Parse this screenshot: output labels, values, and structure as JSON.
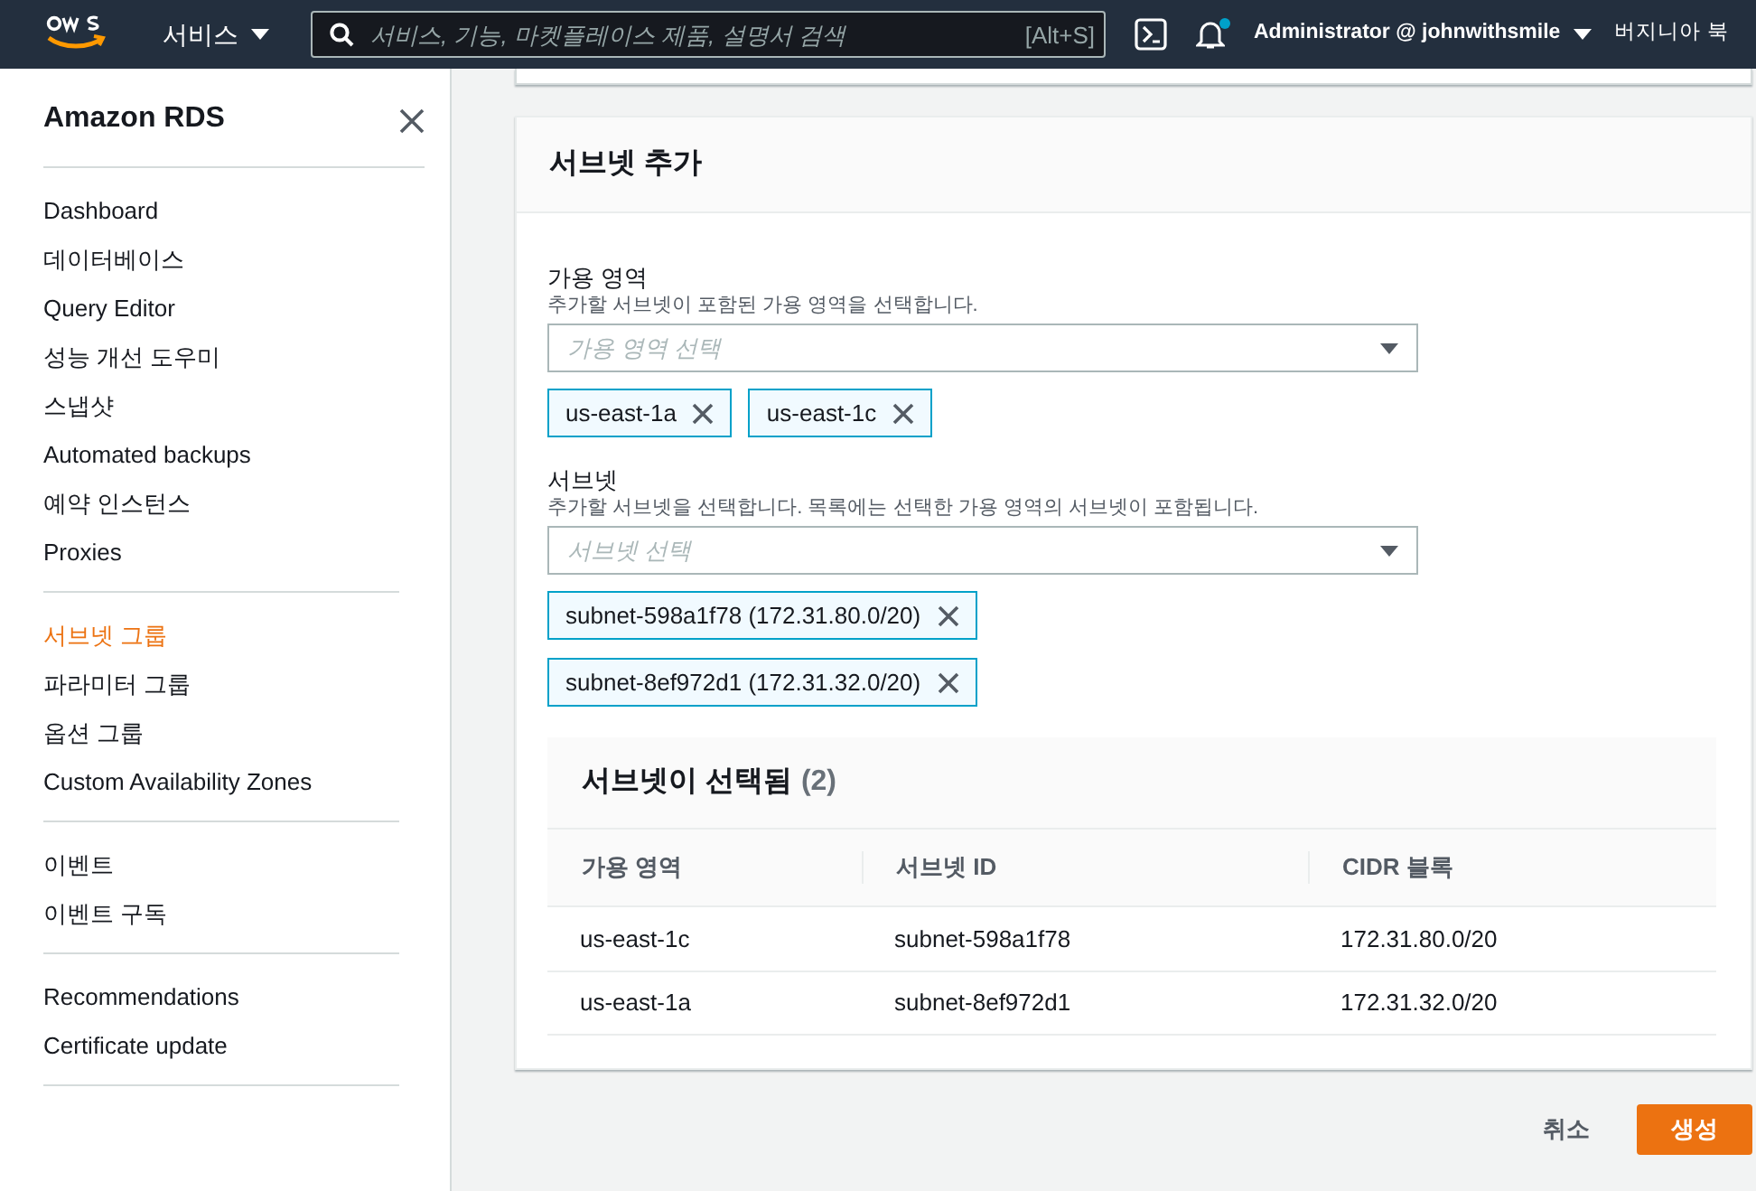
{
  "navbar": {
    "services_label": "서비스",
    "search": {
      "placeholder": "서비스, 기능, 마켓플레이스 제품, 설명서 검색",
      "shortcut": "[Alt+S]"
    },
    "notifications": {
      "unread": true
    },
    "account": "Administrator @ johnwithsmile",
    "region": "버지니아 북"
  },
  "sidebar": {
    "title": "Amazon RDS",
    "groups": [
      [
        {
          "label": "Dashboard",
          "selected": false
        },
        {
          "label": "데이터베이스",
          "selected": false
        },
        {
          "label": "Query Editor",
          "selected": false
        },
        {
          "label": "성능 개선 도우미",
          "selected": false
        },
        {
          "label": "스냅샷",
          "selected": false
        },
        {
          "label": "Automated backups",
          "selected": false
        },
        {
          "label": "예약 인스턴스",
          "selected": false
        },
        {
          "label": "Proxies",
          "selected": false
        }
      ],
      [
        {
          "label": "서브넷 그룹",
          "selected": true
        },
        {
          "label": "파라미터 그룹",
          "selected": false
        },
        {
          "label": "옵션 그룹",
          "selected": false
        },
        {
          "label": "Custom Availability Zones",
          "selected": false
        }
      ],
      [
        {
          "label": "이벤트",
          "selected": false
        },
        {
          "label": "이벤트 구독",
          "selected": false
        }
      ],
      [
        {
          "label": "Recommendations",
          "selected": false
        },
        {
          "label": "Certificate update",
          "selected": false
        }
      ]
    ]
  },
  "form": {
    "title": "서브넷 추가",
    "fields": [
      {
        "label": "가용 영역",
        "description": "추가할 서브넷이 포함된 가용 영역을 선택합니다.",
        "placeholder": "가용 영역 선택",
        "tokens": [
          "us-east-1a",
          "us-east-1c"
        ]
      },
      {
        "label": "서브넷",
        "description": "추가할 서브넷을 선택합니다. 목록에는 선택한 가용 영역의 서브넷이 포함됩니다.",
        "placeholder": "서브넷 선택",
        "tokens": [
          "subnet-598a1f78 (172.31.80.0/20)",
          "subnet-8ef972d1 (172.31.32.0/20)"
        ]
      }
    ],
    "selected_table": {
      "title": "서브넷이 선택됨",
      "count": "(2)",
      "columns": [
        "가용 영역",
        "서브넷 ID",
        "CIDR 블록"
      ],
      "rows": [
        [
          "us-east-1c",
          "subnet-598a1f78",
          "172.31.80.0/20"
        ],
        [
          "us-east-1a",
          "subnet-8ef972d1",
          "172.31.32.0/20"
        ]
      ]
    }
  },
  "footer": {
    "cancel": "취소",
    "create": "생성"
  }
}
